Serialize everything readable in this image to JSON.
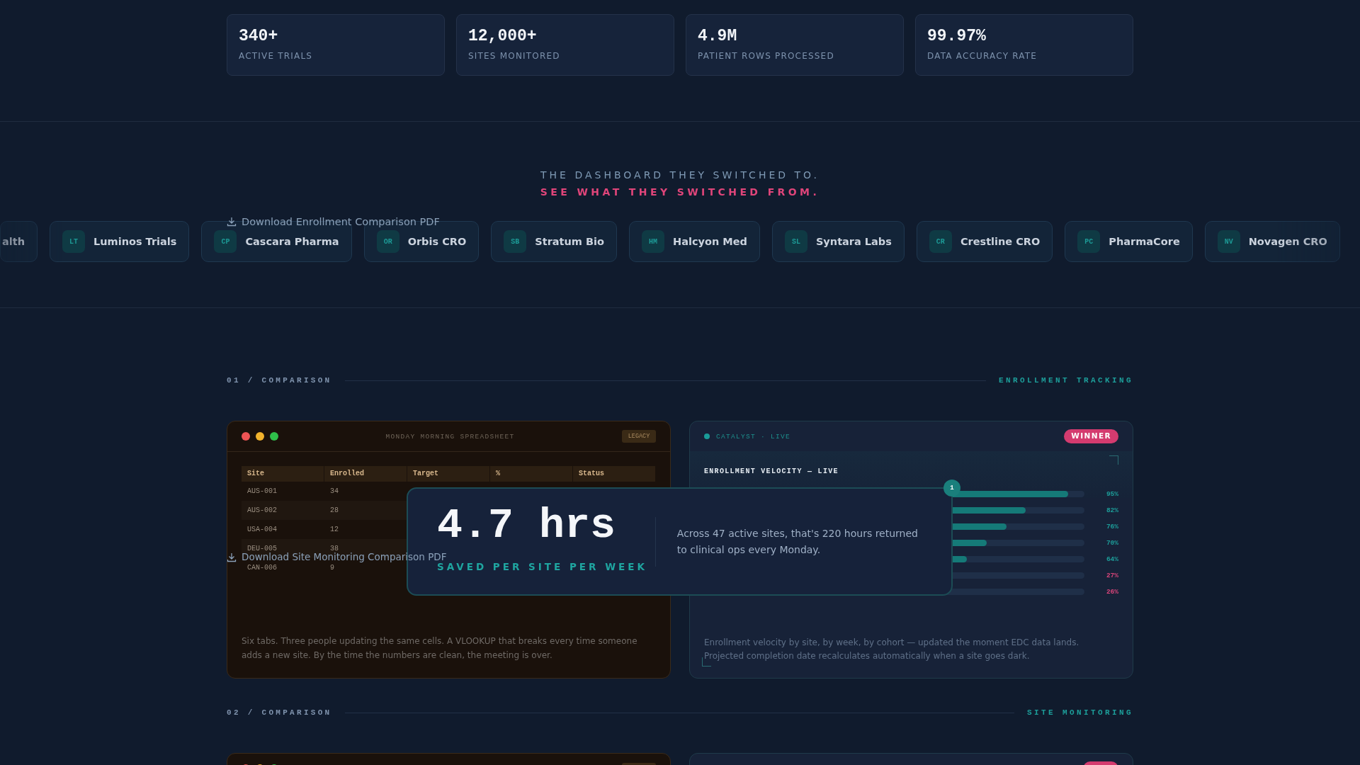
{
  "stats": [
    {
      "value": "340+",
      "label": "ACTIVE TRIALS"
    },
    {
      "value": "12,000+",
      "label": "SITES MONITORED"
    },
    {
      "value": "4.9M",
      "label": "PATIENT ROWS PROCESSED"
    },
    {
      "value": "99.97%",
      "label": "DATA ACCURACY RATE"
    }
  ],
  "switch_heading": {
    "line_1": "THE DASHBOARD THEY SWITCHED TO.",
    "line_2": "SEE WHAT THEY SWITCHED FROM."
  },
  "download_enrollment": {
    "label": "Download Enrollment Comparison PDF"
  },
  "logos": [
    {
      "name": "alth"
    },
    {
      "initials": "LT",
      "name": "Luminos Trials"
    },
    {
      "initials": "CP",
      "name": "Cascara Pharma"
    },
    {
      "initials": "OR",
      "name": "Orbis CRO"
    },
    {
      "initials": "SB",
      "name": "Stratum Bio"
    },
    {
      "initials": "HM",
      "name": "Halcyon Med"
    },
    {
      "initials": "SL",
      "name": "Syntara Labs"
    },
    {
      "initials": "CR",
      "name": "Crestline CRO"
    },
    {
      "initials": "PC",
      "name": "PharmaCore"
    },
    {
      "initials": "NV",
      "name": "Novagen CRO"
    }
  ],
  "comparisons": [
    {
      "number": "01 / COMPARISON",
      "topic": "ENROLLMENT TRACKING",
      "legacy": {
        "title": "MONDAY MORNING SPREADSHEET",
        "tag": "LEGACY",
        "columns": [
          "Site",
          "Enrolled",
          "Target",
          "%",
          "Status"
        ],
        "rows": [
          [
            "AUS-001",
            "34"
          ],
          [
            "AUS-002",
            "28"
          ],
          [
            "USA-004",
            "12"
          ],
          [
            "DEU-005",
            "38"
          ],
          [
            "CAN-006",
            "9"
          ]
        ],
        "caption": "Six tabs. Three people updating the same cells. A VLOOKUP that breaks every time someone adds a new site. By the time the numbers are clean, the meeting is over."
      },
      "catalyst": {
        "source": "CATALYST · LIVE",
        "tag": "WINNER",
        "title": "ENROLLMENT VELOCITY — LIVE",
        "bars": [
          {
            "level": 0.95,
            "reading": "95%",
            "alert": false
          },
          {
            "level": 0.82,
            "reading": "82%",
            "alert": false
          },
          {
            "level": 0.76,
            "reading": "76%",
            "alert": false
          },
          {
            "level": 0.7,
            "reading": "70%",
            "alert": false
          },
          {
            "level": 0.64,
            "reading": "64%",
            "alert": false
          },
          {
            "level": 0.27,
            "reading": "27%",
            "alert": true
          },
          {
            "level": 0.26,
            "reading": "26%",
            "alert": true
          }
        ],
        "caption": "Enrollment velocity by site, by week, by cohort — updated the moment EDC data lands. Projected completion date recalculates automatically when a site goes dark."
      },
      "callout": {
        "value": "4.7 hrs",
        "label": "SAVED PER SITE PER WEEK",
        "text": "Across 47 active sites, that's 220 hours returned to clinical ops every Monday.",
        "step": "1"
      },
      "download": {
        "label": "Download Site Monitoring Comparison PDF"
      }
    },
    {
      "number": "02 / COMPARISON",
      "topic": "SITE MONITORING"
    }
  ]
}
